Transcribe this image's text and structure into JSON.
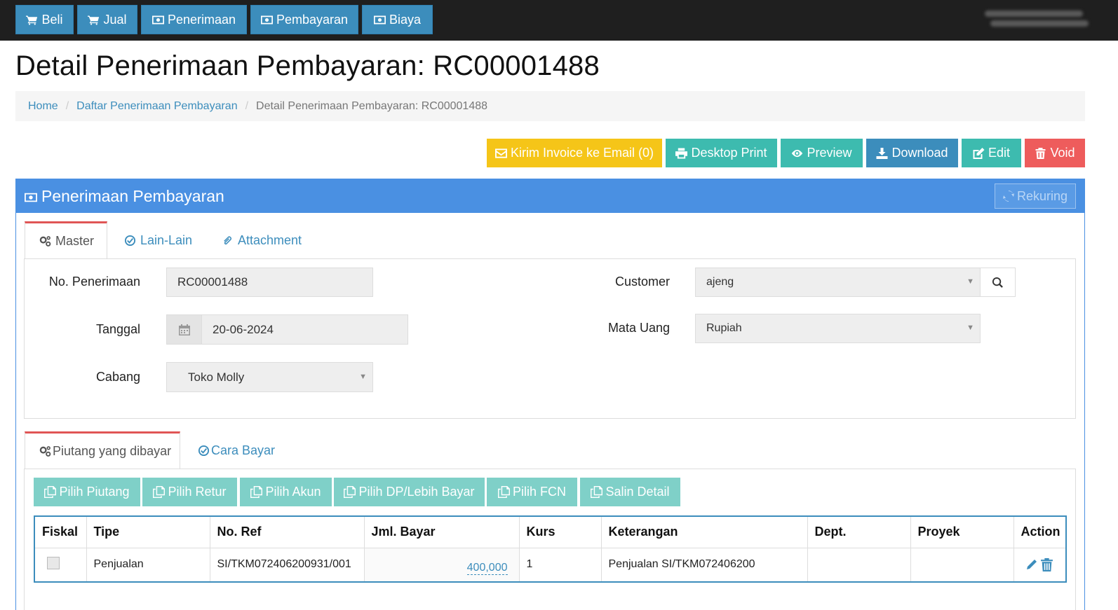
{
  "nav": {
    "beli": "Beli",
    "jual": "Jual",
    "penerimaan": "Penerimaan",
    "pembayaran": "Pembayaran",
    "biaya": "Biaya"
  },
  "page_title": "Detail Penerimaan Pembayaran: RC00001488",
  "breadcrumb": {
    "home": "Home",
    "list": "Daftar Penerimaan Pembayaran",
    "current": "Detail Penerimaan Pembayaran: RC00001488"
  },
  "actions": {
    "email": "Kirim Invoice ke Email (0)",
    "desktop_print": "Desktop Print",
    "preview": "Preview",
    "download": "Download",
    "edit": "Edit",
    "void": "Void",
    "colors": {
      "email": "#f5c518",
      "teal": "#3dbbaf",
      "download": "#3c8dbc",
      "void": "#ee5c5c"
    }
  },
  "panel": {
    "title": "Penerimaan Pembayaran",
    "rekuring": "Rekuring"
  },
  "tabs": {
    "master": "Master",
    "lain": "Lain-Lain",
    "attachment": "Attachment"
  },
  "form": {
    "no_label": "No. Penerimaan",
    "no_value": "RC00001488",
    "tanggal_label": "Tanggal",
    "tanggal_value": "20-06-2024",
    "cabang_label": "Cabang",
    "cabang_value": "Toko Molly",
    "customer_label": "Customer",
    "customer_value": "ajeng",
    "mata_uang_label": "Mata Uang",
    "mata_uang_value": "Rupiah"
  },
  "subtabs": {
    "piutang": "Piutang yang dibayar",
    "cara_bayar": "Cara Bayar"
  },
  "pick": {
    "piutang": "Pilih Piutang",
    "retur": "Pilih Retur",
    "akun": "Pilih Akun",
    "dp": "Pilih DP/Lebih Bayar",
    "fcn": "Pilih FCN",
    "salin": "Salin Detail"
  },
  "table": {
    "headers": [
      "Fiskal",
      "Tipe",
      "No. Ref",
      "Jml. Bayar",
      "Kurs",
      "Keterangan",
      "Dept.",
      "Proyek",
      "Action"
    ],
    "rows": [
      {
        "tipe": "Penjualan",
        "no_ref": "SI/TKM072406200931/001",
        "jml_bayar": "400,000",
        "kurs": "1",
        "keterangan": "Penjualan SI/TKM072406200",
        "dept": "",
        "proyek": ""
      }
    ]
  }
}
